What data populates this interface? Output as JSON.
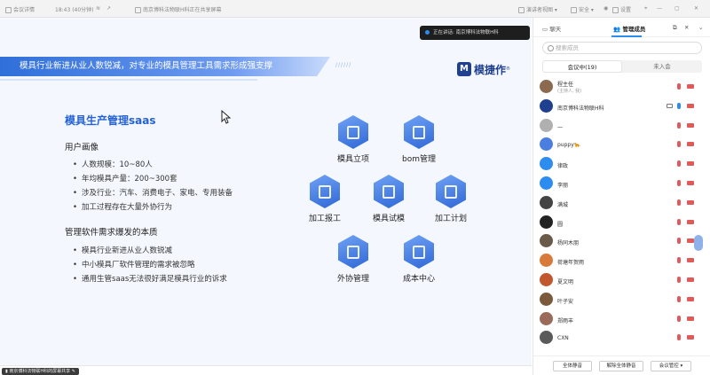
{
  "titlebar": {
    "app_label": "会议详情",
    "time_info": "18:43 (40分钟)",
    "sharing_notice": "南京博科法物联H科正在共享屏幕",
    "view_label": "演讲者视图",
    "security_label": "安全",
    "settings_label": "设置"
  },
  "stage": {
    "speaker_prefix": "正在讲话:",
    "speaker_name": "南京博科法物联H科",
    "banner_text": "模具行业新进从业人数锐减，对专业的模具管理工具需求形成强支撑",
    "banner_dots": "//////",
    "logo_mark": "M",
    "logo_text": "模捷作",
    "logo_reg": "®",
    "title": "模具生产管理saas",
    "section1_heading": "用户画像",
    "section1_items": [
      "人数规模：10~80人",
      "年均模具产量：200~300套",
      "涉及行业：汽车、消费电子、家电、专用装备",
      "加工过程存在大量外协行为"
    ],
    "section2_heading": "管理软件需求爆发的本质",
    "section2_items": [
      "模具行业新进从业人数锐减",
      "中小模具厂软件管理的需求被忽略",
      "通用生管saas无法很好满足模具行业的诉求"
    ],
    "nodes": [
      "模具立项",
      "bom管理",
      "加工报工",
      "模具试模",
      "加工计划",
      "外协管理",
      "成本中心"
    ],
    "share_tag": "南京博科法物联H科的屏幕共享"
  },
  "panel": {
    "tab_chat": "聊天",
    "tab_members": "管理成员",
    "search_placeholder": "搜索成员",
    "seg_in_meeting": "会议中(19)",
    "seg_not_joined": "未入会",
    "members": [
      {
        "name": "程主任",
        "sub": "(主持人, 我)",
        "color": "#8c6a4f"
      },
      {
        "name": "南京博科法物联H科",
        "sub": "",
        "color": "#1f3f8f"
      },
      {
        "name": "一",
        "sub": "",
        "color": "#b0b0b0"
      },
      {
        "name": "puppy🐆",
        "sub": "",
        "color": "#4a7fe0"
      },
      {
        "name": "律政",
        "sub": "",
        "color": "#2d8cf0"
      },
      {
        "name": "李丽",
        "sub": "",
        "color": "#2d8cf0"
      },
      {
        "name": "满城",
        "sub": "",
        "color": "#444444"
      },
      {
        "name": "圆",
        "sub": "",
        "color": "#222222"
      },
      {
        "name": "杨同木朋",
        "sub": "",
        "color": "#6a5a4a"
      },
      {
        "name": "荷塘年贺雨",
        "sub": "",
        "color": "#d87a3a"
      },
      {
        "name": "夏文明",
        "sub": "",
        "color": "#c2562e"
      },
      {
        "name": "叶子安",
        "sub": "",
        "color": "#7a5a3a"
      },
      {
        "name": "郑雨丰",
        "sub": "",
        "color": "#9a6a5a"
      },
      {
        "name": "CXN",
        "sub": "",
        "color": "#5a5a5a"
      }
    ],
    "btn_mute_all": "全体静音",
    "btn_unmute_all": "解除全体静音",
    "btn_control": "会议管控"
  }
}
